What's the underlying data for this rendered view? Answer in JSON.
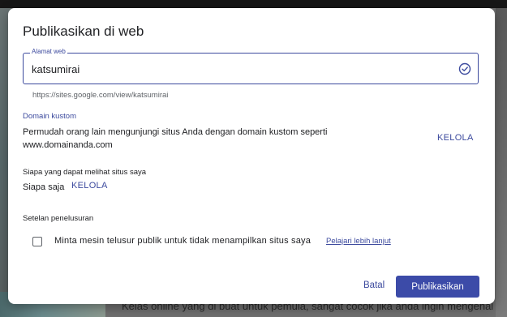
{
  "background": {
    "partial_text": "Kelas online yang di buat untuk pemula, sangat cocok jika anda ingin mengenal"
  },
  "dialog": {
    "title": "Publikasikan di web",
    "address_field": {
      "label": "Alamat web",
      "value": "katsumirai",
      "status_icon": "check-circle-icon"
    },
    "url_hint": "https://sites.google.com/view/katsumirai",
    "custom_domain": {
      "heading": "Domain kustom",
      "description_line1": "Permudah orang lain mengunjungi situs Anda dengan domain kustom seperti",
      "description_line2": "www.domainanda.com",
      "manage_label": "KELOLA"
    },
    "visibility": {
      "heading": "Siapa yang dapat melihat situs saya",
      "value": "Siapa saja",
      "manage_label": "KELOLA"
    },
    "search": {
      "heading": "Setelan penelusuran",
      "checkbox_label": "Minta mesin telusur publik untuk tidak menampilkan situs saya",
      "checked": false,
      "learn_more": "Pelajari lebih lanjut"
    },
    "actions": {
      "cancel": "Batal",
      "publish": "Publikasikan"
    }
  },
  "colors": {
    "accent": "#3c4ba8",
    "link": "#3c4a9e",
    "overlay": "#6f6f6f",
    "spellcheck": "#e0332a"
  }
}
